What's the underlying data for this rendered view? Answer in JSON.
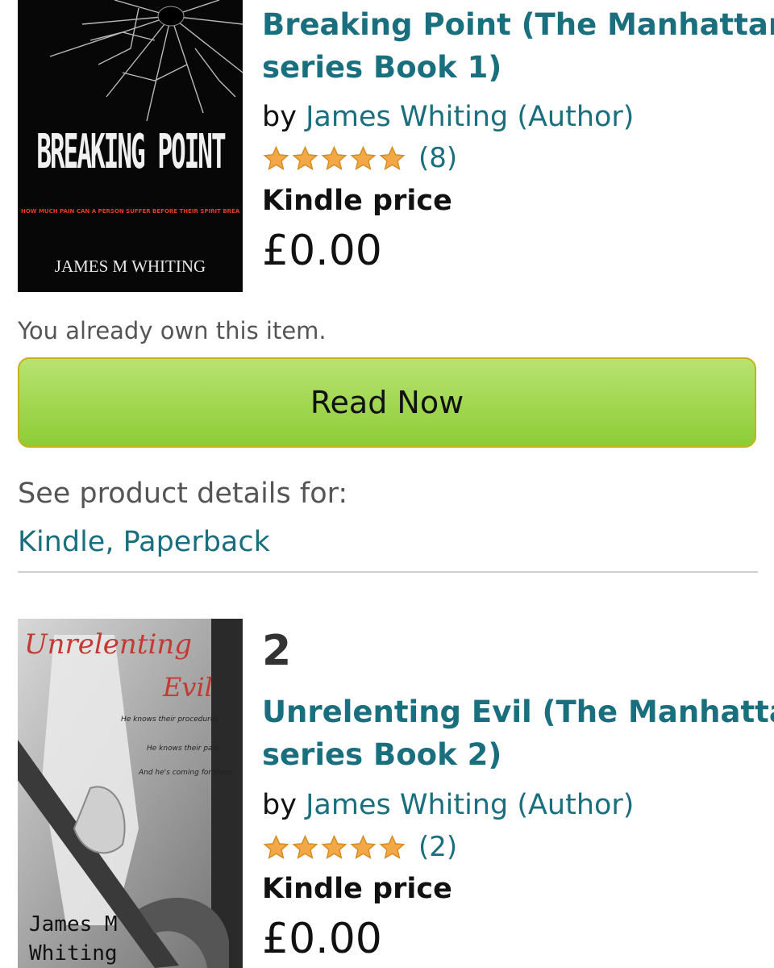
{
  "books": [
    {
      "title_line1": "Breaking Point (The Manhattan",
      "title_line2": "series Book 1)",
      "by_prefix": "by",
      "author": "James Whiting (Author)",
      "rating": 5,
      "review_count": "(8)",
      "price_label": "Kindle price",
      "price": "£0.00",
      "cover": {
        "title": "BREAKING POINT",
        "tagline": "HOW MUCH PAIN CAN A PERSON SUFFER BEFORE THEIR SPIRIT BREAKS",
        "author": "JAMES M WHITING"
      }
    },
    {
      "sequence": "2",
      "title_line1": "Unrelenting Evil (The Manhattan",
      "title_line2": "series Book 2)",
      "by_prefix": "by",
      "author": "James Whiting (Author)",
      "rating": 5,
      "review_count": "(2)",
      "price_label": "Kindle price",
      "price": "£0.00",
      "cover": {
        "title_line1": "Unrelenting",
        "title_line2": "Evil",
        "blurb1": "He knows their procedures",
        "blurb2": "He knows their past",
        "blurb3": "And he's coming for them",
        "author_line1": "James M",
        "author_line2": "Whiting"
      }
    }
  ],
  "owned_notice": "You already own this item.",
  "read_now_label": "Read Now",
  "details_label": "See product details for:",
  "formats_label": "Kindle, Paperback",
  "colors": {
    "link": "#1a6f7e",
    "star": "#f3a847",
    "button": "#a6d955"
  }
}
